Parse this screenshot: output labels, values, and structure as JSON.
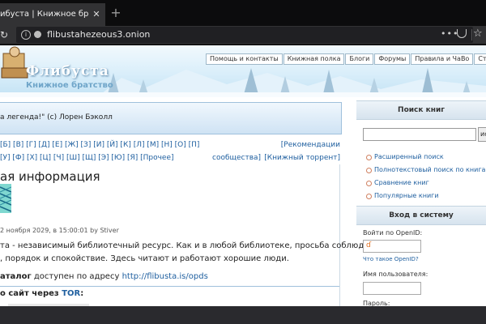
{
  "browser": {
    "tab_title": "ибуста | Книжное братство",
    "url": "flibustahezeous3.onion",
    "menu_dots": "•••"
  },
  "header": {
    "site_name": "Флибуста",
    "slogan": "Книжное братство",
    "nav": [
      {
        "label": "Помощь и контакты"
      },
      {
        "label": "Книжная полка"
      },
      {
        "label": "Блоги"
      },
      {
        "label": "Форумы"
      },
      {
        "label": "Правила и ЧаВо"
      },
      {
        "label": "Сту"
      }
    ]
  },
  "quote": "а легенда!\" (с) Лорен Бэколл",
  "alphabet": {
    "row1": "[Б] [В] [Г] [Д] [Е] [Ж] [З] [И] [Й] [К] [Л] [М] [Н] [О] [П]",
    "row2": "[У] [Ф] [Х] [Ц] [Ч] [Ш] [Щ] [Э] [Ю] [Я] [Прочее]",
    "recommendations": "[Рекомендации",
    "communities": "сообщества]",
    "torrent": "[Книжный торрент]"
  },
  "news": {
    "title": "ая информация",
    "date": "2 ноября 2029, в 15:00:01 by Stiver",
    "line1": "та - независимый библиотечный ресурс. Как и в любой библиотеке, просьба соблюдать",
    "line2": ", порядок и спокойствие. Здесь читают и работают хорошие люди.",
    "opds_bold": "аталог",
    "opds_text": " доступен по адресу ",
    "opds_url": "http://flibusta.is/opds",
    "tor_text": "о сайт через ",
    "tor_link": "TOR",
    "tor_colon": ":"
  },
  "sidebar": {
    "search_title": "Поиск книг",
    "search_button": "ис",
    "links": [
      {
        "label": "Расширенный поиск"
      },
      {
        "label": "Полнотекстовый поиск по книгам"
      },
      {
        "label": "Сравнение книг"
      },
      {
        "label": "Популярные книги"
      }
    ],
    "login_title": "Вход в систему",
    "openid_label": "Войти по OpenID:",
    "openid_what": "Что такое OpenID?",
    "username_label": "Имя пользователя:",
    "password_label": "Пароль:"
  }
}
